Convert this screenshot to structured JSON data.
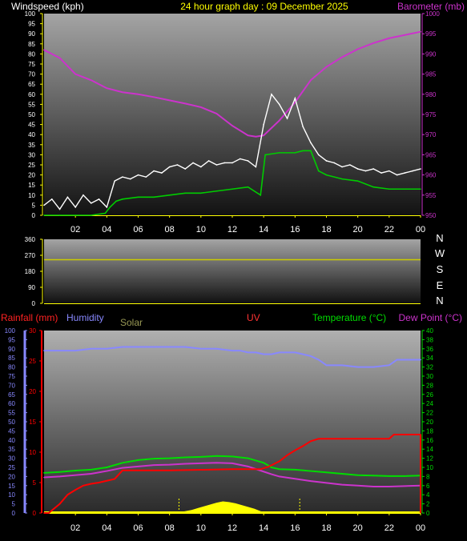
{
  "header": {
    "left": "Windspeed (kph)",
    "center": "24 hour graph day : 09 December 2025",
    "right": "Barometer (mb)"
  },
  "direction_labels": [
    "N",
    "W",
    "S",
    "E",
    "N"
  ],
  "bottom_header": {
    "rainfall": "Rainfall (mm)",
    "humidity": "Humidity",
    "solar": "Solar",
    "uv": "UV",
    "temperature": "Temperature (°C)",
    "dewpoint": "Dew Point (°C)"
  },
  "colors": {
    "wind_gust": "#ffffff",
    "wind_avg": "#00cc00",
    "barometer": "#cc33cc",
    "direction": "#cccc00",
    "rainfall": "#ff0000",
    "humidity": "#8888ff",
    "solar": "#ffff00",
    "temperature": "#00dd00",
    "dewpoint": "#cc33cc",
    "axis": "#ffff00"
  },
  "chart_data": [
    {
      "type": "line",
      "title": "24 hour graph day : 09 December 2025",
      "x_tick_labels": [
        "02",
        "04",
        "06",
        "08",
        "10",
        "12",
        "14",
        "16",
        "18",
        "20",
        "22",
        "00"
      ],
      "x_hours": [
        2,
        4,
        6,
        8,
        10,
        12,
        14,
        16,
        18,
        20,
        22,
        24
      ],
      "left_axis": {
        "label": "Windspeed (kph)",
        "ylim": [
          0,
          100
        ],
        "ticks": [
          0,
          5,
          10,
          15,
          20,
          25,
          30,
          35,
          40,
          45,
          50,
          55,
          60,
          65,
          70,
          75,
          80,
          85,
          90,
          95,
          100
        ]
      },
      "right_axis": {
        "label": "Barometer (mb)",
        "ylim": [
          950,
          1000
        ],
        "ticks": [
          950,
          955,
          960,
          965,
          970,
          975,
          980,
          985,
          990,
          995,
          1000
        ]
      },
      "series": [
        {
          "name": "Wind gust",
          "axis": "left",
          "x": [
            0,
            0.5,
            1,
            1.5,
            2,
            2.5,
            3,
            3.5,
            4,
            4.5,
            5,
            5.5,
            6,
            6.5,
            7,
            7.5,
            8,
            8.5,
            9,
            9.5,
            10,
            10.5,
            11,
            11.5,
            12,
            12.5,
            13,
            13.5,
            14,
            14.5,
            15,
            15.5,
            16,
            16.5,
            17,
            17.5,
            18,
            18.5,
            19,
            19.5,
            20,
            20.5,
            21,
            21.5,
            22,
            22.5,
            23,
            23.5,
            24
          ],
          "values": [
            5,
            8,
            3,
            9,
            4,
            10,
            6,
            8,
            4,
            17,
            19,
            18,
            20,
            19,
            22,
            21,
            24,
            25,
            23,
            26,
            24,
            27,
            25,
            26,
            26,
            28,
            27,
            24,
            45,
            60,
            55,
            48,
            58,
            44,
            36,
            30,
            27,
            26,
            24,
            25,
            23,
            22,
            23,
            21,
            22,
            20,
            21,
            22,
            23
          ]
        },
        {
          "name": "Wind average",
          "axis": "left",
          "x": [
            0,
            1,
            2,
            3,
            3.9,
            4.2,
            4.6,
            5,
            6,
            7,
            8,
            9,
            10,
            11,
            12,
            13,
            13.8,
            14.1,
            15,
            16,
            16.5,
            17,
            17.5,
            18,
            19,
            20,
            21,
            22,
            23,
            24
          ],
          "values": [
            0,
            0,
            0,
            0,
            1,
            4,
            7,
            8,
            9,
            9,
            10,
            11,
            11,
            12,
            13,
            14,
            10,
            30,
            31,
            31,
            32,
            32,
            22,
            20,
            18,
            17,
            14,
            13,
            13,
            13
          ]
        },
        {
          "name": "Barometer",
          "axis": "right",
          "x": [
            0,
            1,
            2,
            3,
            4,
            5,
            6,
            7,
            8,
            9,
            10,
            11,
            12,
            13,
            13.5,
            14,
            15,
            16,
            17,
            18,
            19,
            20,
            21,
            22,
            23,
            24
          ],
          "values": [
            991,
            989,
            985,
            983.5,
            981.5,
            980.5,
            980,
            979.3,
            978.5,
            977.7,
            976.8,
            975.2,
            972.2,
            969.8,
            969.5,
            969.8,
            973.5,
            978,
            983.5,
            986.8,
            989.2,
            991.2,
            992.7,
            993.9,
            994.7,
            995.5
          ]
        }
      ]
    },
    {
      "type": "line",
      "x_hours": [
        0,
        24
      ],
      "y_tick_labels": [
        0,
        90,
        180,
        270,
        360
      ],
      "ylim": [
        0,
        360
      ],
      "series": [
        {
          "name": "Wind direction",
          "x": [
            0,
            24
          ],
          "values": [
            245,
            245
          ]
        }
      ]
    },
    {
      "type": "line",
      "x_tick_labels": [
        "02",
        "04",
        "06",
        "08",
        "10",
        "12",
        "14",
        "16",
        "18",
        "20",
        "22",
        "00"
      ],
      "x_hours": [
        2,
        4,
        6,
        8,
        10,
        12,
        14,
        16,
        18,
        20,
        22,
        24
      ],
      "humidity_axis": {
        "ylim": [
          0,
          100
        ],
        "ticks": [
          0,
          5,
          10,
          15,
          20,
          25,
          30,
          35,
          40,
          45,
          50,
          55,
          60,
          65,
          70,
          75,
          80,
          85,
          90,
          95,
          100
        ]
      },
      "rain_axis": {
        "ylim": [
          0,
          30
        ],
        "ticks": [
          0,
          5,
          10,
          15,
          20,
          25,
          30
        ]
      },
      "temp_axis": {
        "ylim": [
          0,
          40
        ],
        "ticks": [
          0,
          2,
          4,
          6,
          8,
          10,
          12,
          14,
          16,
          18,
          20,
          22,
          24,
          26,
          28,
          30,
          32,
          34,
          36,
          38,
          40
        ]
      },
      "series": [
        {
          "name": "Humidity",
          "axis": "humidity",
          "x": [
            0,
            1,
            2,
            3,
            4,
            5,
            6,
            7,
            8,
            9,
            10,
            11,
            12,
            12.5,
            13,
            13.5,
            14,
            14.5,
            15,
            16,
            16.5,
            17,
            17.5,
            18,
            19,
            20,
            21,
            22,
            22.5,
            23,
            24
          ],
          "values": [
            89,
            89,
            89,
            90,
            90,
            91,
            91,
            91,
            91,
            91,
            90,
            90,
            89,
            89,
            88,
            88,
            87,
            87,
            88,
            88,
            87,
            86,
            84,
            81,
            81,
            80,
            80,
            81,
            84,
            84,
            84
          ]
        },
        {
          "name": "Rainfall",
          "axis": "rain",
          "x": [
            0,
            0.3,
            1,
            1.5,
            2,
            2.5,
            3,
            3.5,
            4,
            4.5,
            5,
            5.5,
            6,
            8,
            10,
            12,
            13,
            13.8,
            14.3,
            15,
            15.5,
            16,
            16.5,
            17,
            17.5,
            18,
            19,
            20,
            21,
            22,
            22.3,
            23,
            24
          ],
          "values": [
            0,
            0,
            1.5,
            3,
            3.8,
            4.5,
            4.8,
            5,
            5.3,
            5.6,
            7,
            7,
            7,
            7,
            7.1,
            7.2,
            7.2,
            7.2,
            7.6,
            8.5,
            9.5,
            10.3,
            11,
            11.8,
            12.2,
            12.2,
            12.2,
            12.2,
            12.2,
            12.2,
            12.9,
            12.9,
            12.9
          ]
        },
        {
          "name": "Temperature",
          "axis": "temp",
          "x": [
            0,
            1,
            2,
            3,
            4,
            5,
            6,
            7,
            8,
            9,
            10,
            11,
            12,
            13,
            14,
            14.5,
            15,
            16,
            17,
            18,
            19,
            20,
            21,
            22,
            23,
            24
          ],
          "values": [
            8.8,
            9,
            9.3,
            9.5,
            10,
            11,
            11.6,
            11.9,
            12,
            12.2,
            12.3,
            12.5,
            12.4,
            12,
            11,
            10,
            9.6,
            9.5,
            9.2,
            8.9,
            8.6,
            8.3,
            8.2,
            8.1,
            8.1,
            8.2
          ]
        },
        {
          "name": "Dew Point",
          "axis": "temp",
          "x": [
            0,
            1,
            2,
            3,
            4,
            5,
            6,
            7,
            8,
            9,
            10,
            11,
            12,
            13,
            13.8,
            14.5,
            15,
            16,
            17,
            18,
            19,
            20,
            21,
            22,
            23,
            24
          ],
          "values": [
            7.8,
            8,
            8.3,
            8.6,
            9.2,
            9.9,
            10.2,
            10.5,
            10.6,
            10.8,
            10.9,
            11,
            10.9,
            10.2,
            9.3,
            8.5,
            8,
            7.5,
            7,
            6.6,
            6.2,
            6,
            5.8,
            5.8,
            5.9,
            6
          ]
        },
        {
          "name": "Solar",
          "axis": "rain",
          "x": [
            8.6,
            9,
            9.4,
            9.8,
            10.2,
            10.6,
            11,
            11.4,
            11.8,
            12.2,
            12.6,
            13,
            13.4,
            13.8,
            14.2
          ],
          "values": [
            0.1,
            0.3,
            0.5,
            0.8,
            1.1,
            1.4,
            1.7,
            1.9,
            1.8,
            1.6,
            1.3,
            1.0,
            0.7,
            0.3,
            0.1
          ]
        }
      ]
    }
  ]
}
